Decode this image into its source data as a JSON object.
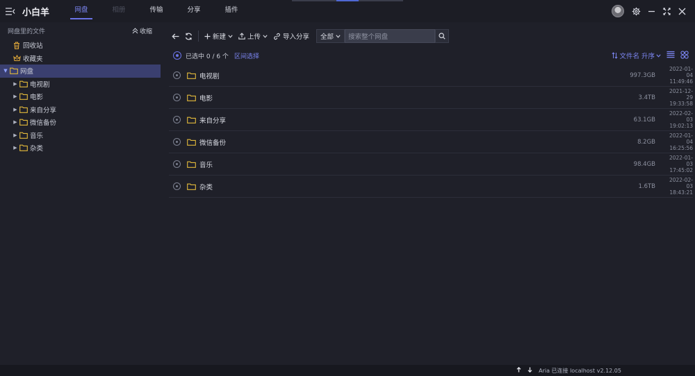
{
  "app": {
    "title": "小白羊"
  },
  "nav": {
    "tabs": [
      {
        "label": "网盘",
        "active": true,
        "disabled": false
      },
      {
        "label": "相册",
        "active": false,
        "disabled": true
      },
      {
        "label": "传输",
        "active": false,
        "disabled": false
      },
      {
        "label": "分享",
        "active": false,
        "disabled": false
      },
      {
        "label": "插件",
        "active": false,
        "disabled": false
      }
    ]
  },
  "sidebar": {
    "header": "网盘里的文件",
    "collapse_label": "收缩",
    "items": [
      {
        "label": "回收站",
        "icon": "trash-icon",
        "level": 0,
        "selected": false,
        "expander": false
      },
      {
        "label": "收藏夹",
        "icon": "crown-icon",
        "level": 0,
        "selected": false,
        "expander": false
      },
      {
        "label": "网盘",
        "icon": "folder-icon",
        "level": 0,
        "selected": true,
        "expander": true
      },
      {
        "label": "电视剧",
        "icon": "folder-icon",
        "level": 1,
        "selected": false,
        "expander": true
      },
      {
        "label": "电影",
        "icon": "folder-icon",
        "level": 1,
        "selected": false,
        "expander": true
      },
      {
        "label": "来自分享",
        "icon": "folder-icon",
        "level": 1,
        "selected": false,
        "expander": true
      },
      {
        "label": "微信备份",
        "icon": "folder-icon",
        "level": 1,
        "selected": false,
        "expander": true
      },
      {
        "label": "音乐",
        "icon": "folder-icon",
        "level": 1,
        "selected": false,
        "expander": true
      },
      {
        "label": "杂类",
        "icon": "folder-icon",
        "level": 1,
        "selected": false,
        "expander": true
      }
    ]
  },
  "toolbar": {
    "new_label": "新建",
    "upload_label": "上传",
    "import_share_label": "导入分享",
    "filter_label": "全部",
    "search_placeholder": "搜索整个网盘"
  },
  "selection": {
    "text": "已选中 0 / 6 个",
    "range_select_label": "区间选择",
    "sort_label": "文件名 升序"
  },
  "files": [
    {
      "name": "电视剧",
      "size": "997.3GB",
      "date": "2022-01-04",
      "time": "11:49:46"
    },
    {
      "name": "电影",
      "size": "3.4TB",
      "date": "2021-12-29",
      "time": "19:33:58"
    },
    {
      "name": "来自分享",
      "size": "63.1GB",
      "date": "2022-02-03",
      "time": "19:02:13"
    },
    {
      "name": "微信备份",
      "size": "8.2GB",
      "date": "2022-01-04",
      "time": "16:25:56"
    },
    {
      "name": "音乐",
      "size": "98.4GB",
      "date": "2022-01-03",
      "time": "17:45:02"
    },
    {
      "name": "杂类",
      "size": "1.6TB",
      "date": "2022-02-03",
      "time": "18:43:21"
    }
  ],
  "status": {
    "aria_text": "Aria 已连接 localhost",
    "version": "v2.12.05"
  },
  "colors": {
    "accent": "#6a73e6",
    "folder": "#e2b93b",
    "trash": "#e0a83a",
    "background": "#1f2029"
  }
}
